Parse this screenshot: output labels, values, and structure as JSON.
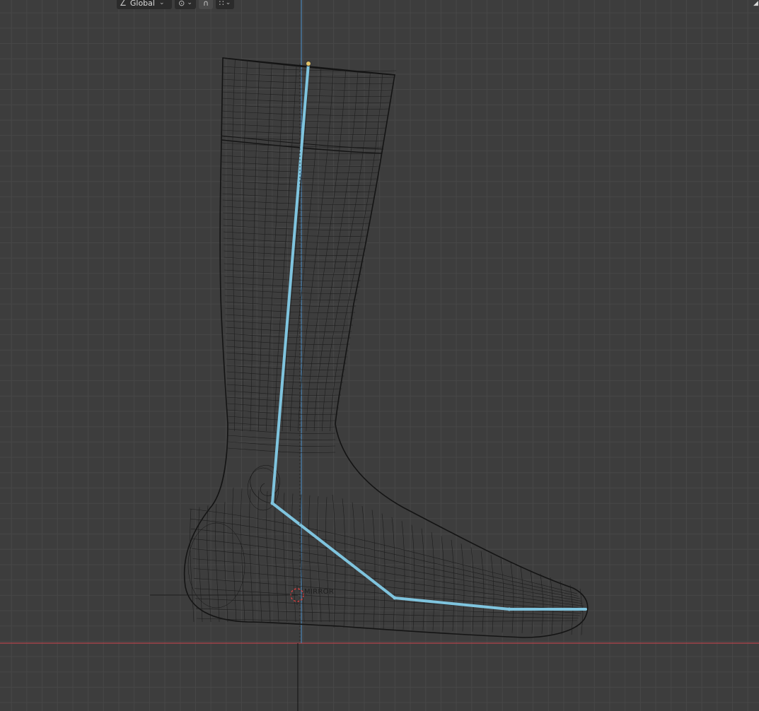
{
  "header": {
    "orientation": {
      "label": "Global",
      "icon": "transform-orientation-icon"
    },
    "pivot": {
      "icon": "pivot-point-icon"
    },
    "snap_toggle": {
      "icon": "snap-magnet-icon",
      "active": true
    },
    "snap_target": {
      "icon": "snap-grid-icon"
    }
  },
  "viewport": {
    "background": "#3d3d3d",
    "grid_color": "#474747",
    "x_axis_color": "#b4444c",
    "z_axis_color": "#4b86b6",
    "wire_color": "#141414",
    "bone_color": "#7fc4de",
    "object_label": "MIRROR",
    "cursor_color": "#d93f3f"
  }
}
